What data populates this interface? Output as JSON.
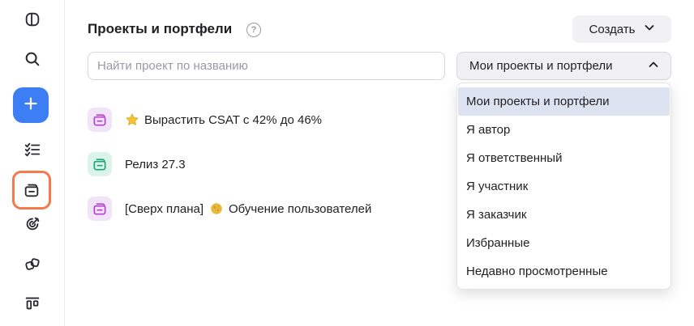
{
  "sidebar": {
    "items": [
      {
        "name": "panel-toggle-icon"
      },
      {
        "name": "search-icon"
      },
      {
        "name": "plus-icon"
      },
      {
        "name": "tasks-icon"
      },
      {
        "name": "portfolio-icon"
      },
      {
        "name": "goals-icon"
      },
      {
        "name": "boards-icon"
      },
      {
        "name": "kanban-icon"
      }
    ],
    "active_color": "#f4794b",
    "create_color": "#3d7ef5"
  },
  "header": {
    "title": "Проекты и портфели",
    "help_glyph": "?",
    "create_label": "Создать"
  },
  "search": {
    "placeholder": "Найти проект по названию",
    "value": ""
  },
  "filter": {
    "selected": "Мои проекты и портфели",
    "options": [
      "Мои проекты и портфели",
      "Я автор",
      "Я ответственный",
      "Я участник",
      "Я заказчик",
      "Избранные",
      "Недавно просмотренные"
    ]
  },
  "projects": [
    {
      "title": "Вырастить CSAT с 42% до 46%",
      "prefix": "",
      "emoji": "star-icon",
      "after_emoji": "",
      "color": "purple"
    },
    {
      "title": "Релиз 27.3",
      "prefix": "",
      "emoji": "",
      "after_emoji": "",
      "color": "green"
    },
    {
      "title": "Обучение пользователей",
      "prefix": "[Сверх плана]",
      "emoji": "moon-icon",
      "after_emoji": "",
      "color": "purple"
    }
  ],
  "colors": {
    "purple_icon": "#b53fd6",
    "purple_bg": "#f1e4f8",
    "green_icon": "#1aa57a",
    "green_bg": "#dcf3ea"
  }
}
